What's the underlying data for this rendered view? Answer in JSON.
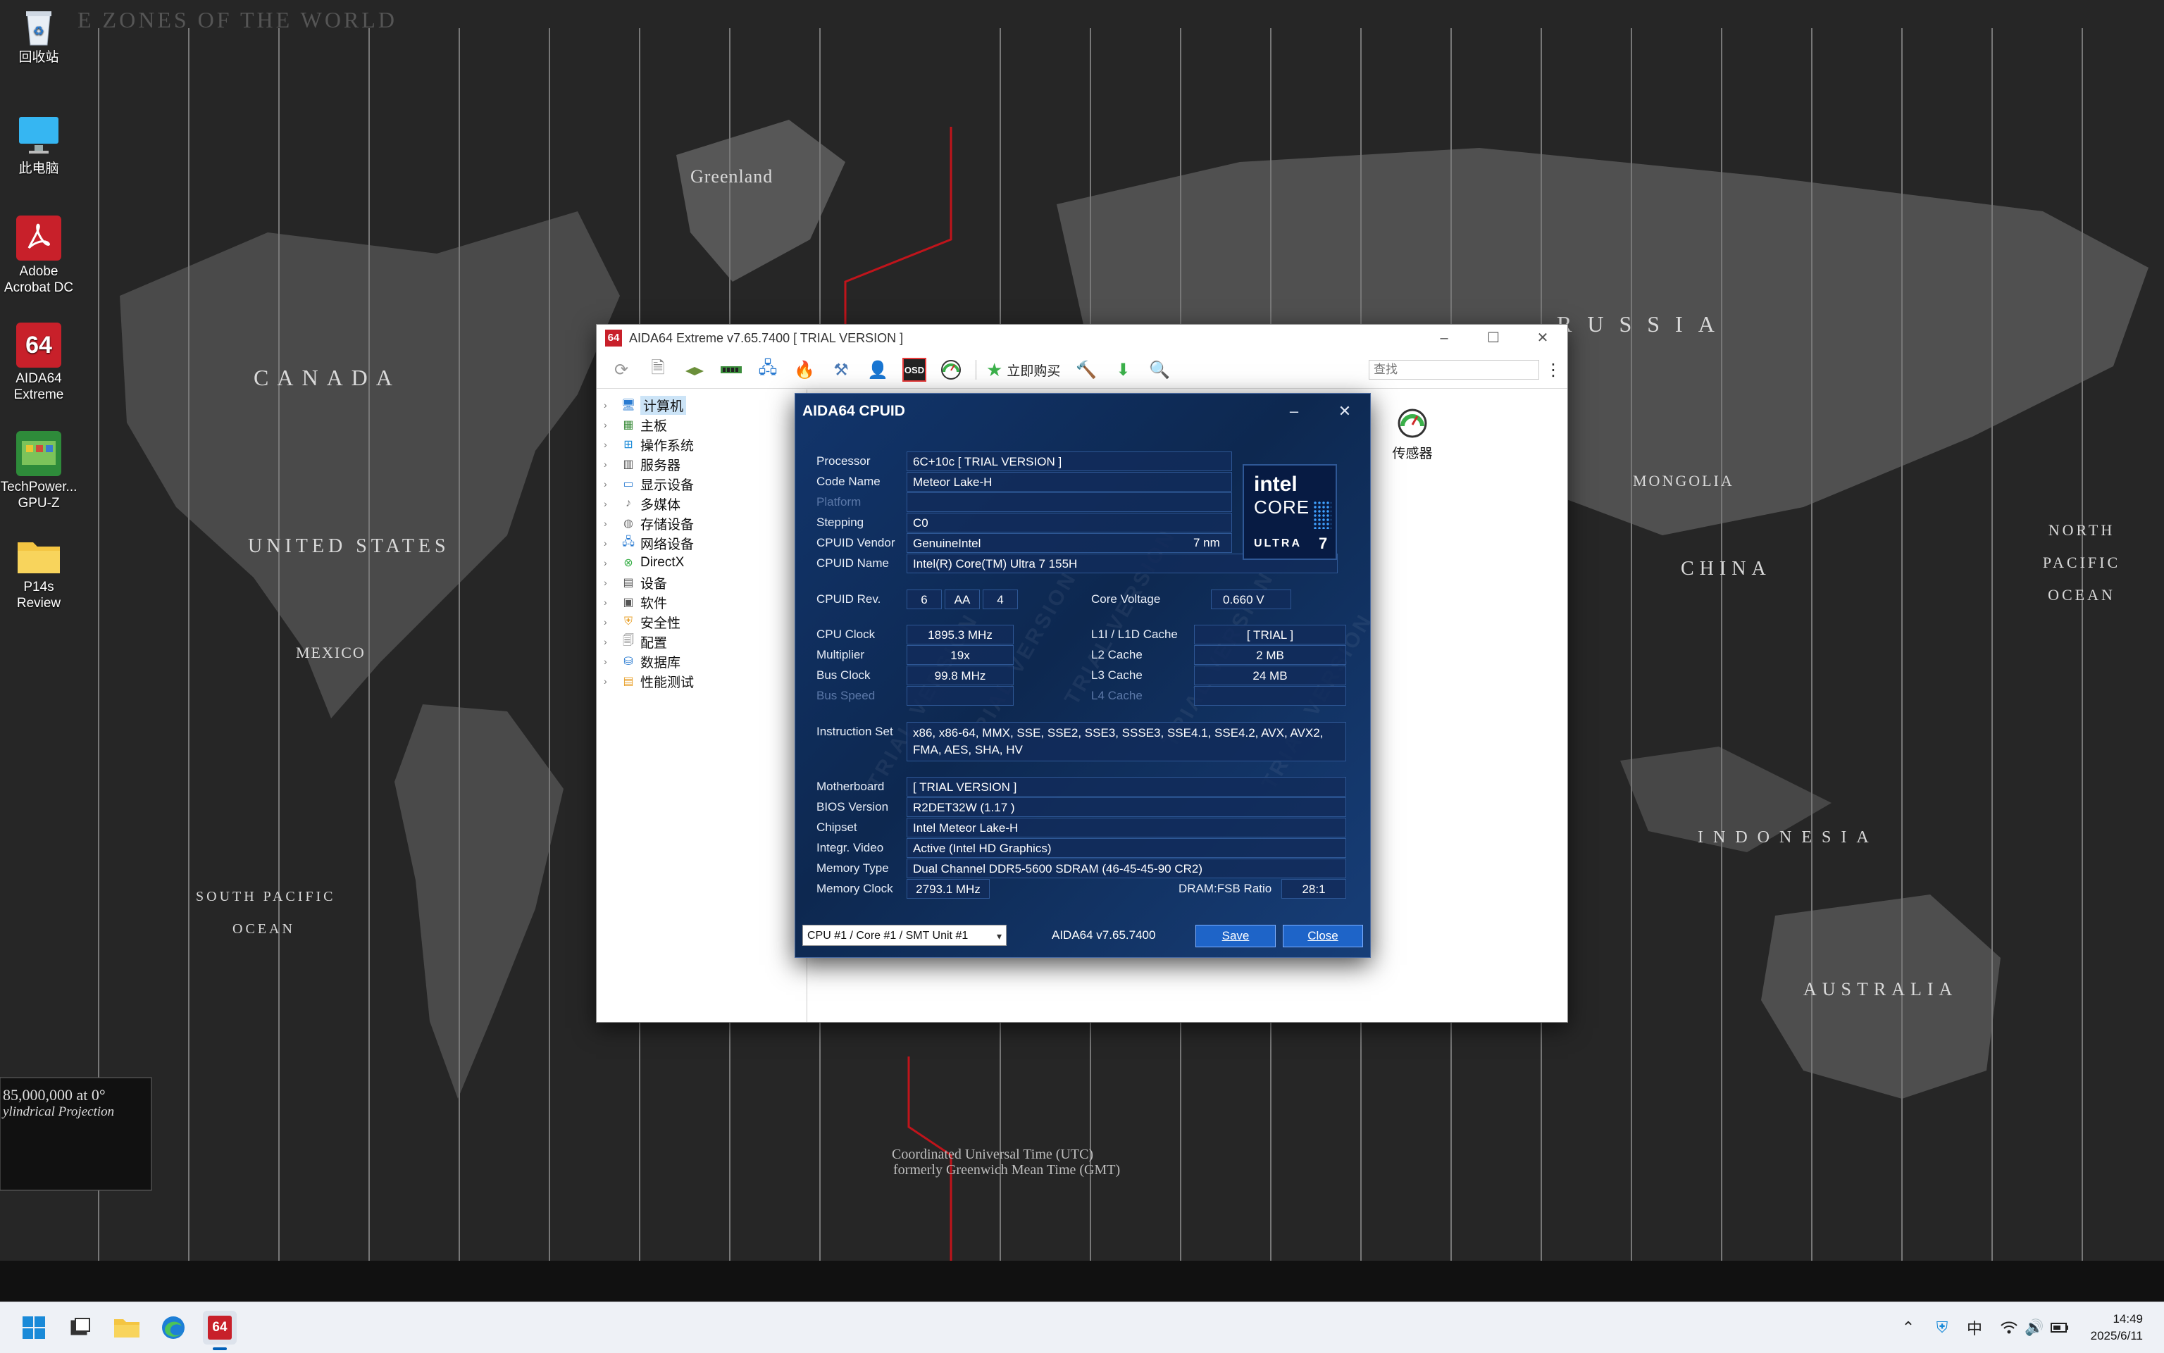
{
  "desktop": {
    "icons": [
      {
        "label": "回收站"
      },
      {
        "label": "此电脑"
      },
      {
        "label": "Adobe Acrobat DC"
      },
      {
        "label": "AIDA64 Extreme"
      },
      {
        "label": "TechPower... GPU-Z"
      },
      {
        "label": "P14s Review"
      }
    ],
    "wallpaper_labels": {
      "canada": "CANADA",
      "united_states": "UNITED STATES",
      "russia": "RUSSIA",
      "china": "CHINA",
      "indonesia": "INDONESIA",
      "australia": "AUSTRALIA",
      "greenland": "Greenland",
      "mexico": "MEXICO",
      "mongolia": "MONGOLIA",
      "south_pacific": "SOUTH PACIFIC",
      "ocean": "OCEAN",
      "north_pacific": "NORTH PACIFIC OCEAN",
      "utc": "Coordinated Universal Time (UTC)",
      "gmt": "formerly Greenwich Mean Time (GMT)",
      "scale": "85,000,000 at 0°",
      "projection": "ylindrical Projection",
      "header": "E ZONES OF THE WORLD"
    }
  },
  "main_window": {
    "title": "AIDA64 Extreme v7.65.7400  [ TRIAL VERSION ]",
    "logo": "64",
    "buy_label": "立即购买",
    "search_placeholder": "查找",
    "tree": [
      {
        "label": "计算机",
        "selected": true
      },
      {
        "label": "主板"
      },
      {
        "label": "操作系统"
      },
      {
        "label": "服务器"
      },
      {
        "label": "显示设备"
      },
      {
        "label": "多媒体"
      },
      {
        "label": "存储设备"
      },
      {
        "label": "网络设备"
      },
      {
        "label": "DirectX"
      },
      {
        "label": "设备"
      },
      {
        "label": "软件"
      },
      {
        "label": "安全性"
      },
      {
        "label": "配置"
      },
      {
        "label": "数据库"
      },
      {
        "label": "性能测试"
      }
    ],
    "sensor_label": "传感器",
    "osd_label": "OSD"
  },
  "cpuid": {
    "title": "AIDA64 CPUID",
    "labels": {
      "processor": "Processor",
      "code_name": "Code Name",
      "platform": "Platform",
      "stepping": "Stepping",
      "cpuid_vendor": "CPUID Vendor",
      "cpuid_name": "CPUID Name",
      "cpuid_rev": "CPUID Rev.",
      "core_voltage": "Core Voltage",
      "cpu_clock": "CPU Clock",
      "multiplier": "Multiplier",
      "bus_clock": "Bus Clock",
      "bus_speed": "Bus Speed",
      "l1_cache": "L1I / L1D Cache",
      "l2_cache": "L2 Cache",
      "l3_cache": "L3 Cache",
      "l4_cache": "L4 Cache",
      "instruction_set": "Instruction Set",
      "motherboard": "Motherboard",
      "bios_version": "BIOS Version",
      "chipset": "Chipset",
      "integr_video": "Integr. Video",
      "memory_type": "Memory Type",
      "memory_clock": "Memory Clock",
      "dram_fsb": "DRAM:FSB Ratio"
    },
    "values": {
      "processor": "6C+10c  [ TRIAL VERSION ]",
      "code_name": "Meteor Lake-H",
      "platform": "",
      "stepping": "C0",
      "cpuid_vendor": "GenuineIntel",
      "process": "7 nm",
      "cpuid_name": "Intel(R) Core(TM) Ultra 7 155H",
      "rev1": "6",
      "rev2": "AA",
      "rev3": "4",
      "core_voltage": "0.660 V",
      "cpu_clock": "1895.3 MHz",
      "multiplier": "19x",
      "bus_clock": "99.8 MHz",
      "bus_speed": "",
      "l1_cache": "[ TRIAL ]",
      "l2_cache": "2 MB",
      "l3_cache": "24 MB",
      "l4_cache": "",
      "instruction_set": "x86, x86-64, MMX, SSE, SSE2, SSE3, SSSE3, SSE4.1, SSE4.2, AVX, AVX2, FMA, AES, SHA, HV",
      "motherboard": "[ TRIAL VERSION ]",
      "bios_version": "R2DET32W (1.17 )",
      "chipset": "Intel Meteor Lake-H",
      "integr_video": "Active  (Intel HD Graphics)",
      "memory_type": "Dual Channel DDR5-5600 SDRAM  (46-45-45-90 CR2)",
      "memory_clock": "2793.1 MHz",
      "dram_fsb": "28:1"
    },
    "badge": {
      "brand": "intel",
      "line": "CORE",
      "tier": "ULTRA",
      "num": "7"
    },
    "watermark": "TRIAL VERSION",
    "footer": {
      "core_select": "CPU #1 / Core #1 / SMT Unit #1",
      "version": "AIDA64 v7.65.7400",
      "save": "Save",
      "close": "Close"
    }
  },
  "taskbar": {
    "app_label": "64",
    "ime": "中",
    "time": "14:49",
    "date": "2025/6/11"
  }
}
